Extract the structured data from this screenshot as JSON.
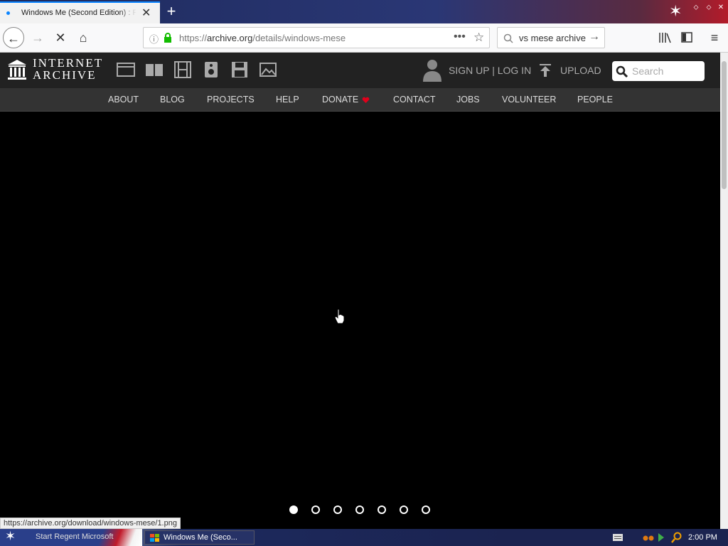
{
  "browser": {
    "tab_title": "Windows Me (Second Edition) : Free",
    "tab_close": "✕",
    "new_tab": "+",
    "url_prefix": "https://",
    "url_host": "archive.org",
    "url_path": "/details/windows-mese",
    "search_text": "vs mese archive",
    "status_url": "https://archive.org/download/windows-mese/1.png"
  },
  "ia": {
    "logo_line1": "INTERNET",
    "logo_line2": "ARCHIVE",
    "signup": "SIGN UP | LOG IN",
    "upload": "UPLOAD",
    "search_placeholder": "Search",
    "nav": [
      "ABOUT",
      "BLOG",
      "PROJECTS",
      "HELP",
      "DONATE",
      "CONTACT",
      "JOBS",
      "VOLUNTEER",
      "PEOPLE"
    ]
  },
  "carousel": {
    "total": 7,
    "active": 1
  },
  "taskbar": {
    "start_label": "Start Regent Microsoft",
    "window_label": "Windows Me (Seco...",
    "clock": "2:00 PM"
  },
  "colors": {
    "accent": "#0a84ff",
    "donate_heart": "#e0001b",
    "ia_header": "#222222",
    "ia_nav": "#333333"
  }
}
